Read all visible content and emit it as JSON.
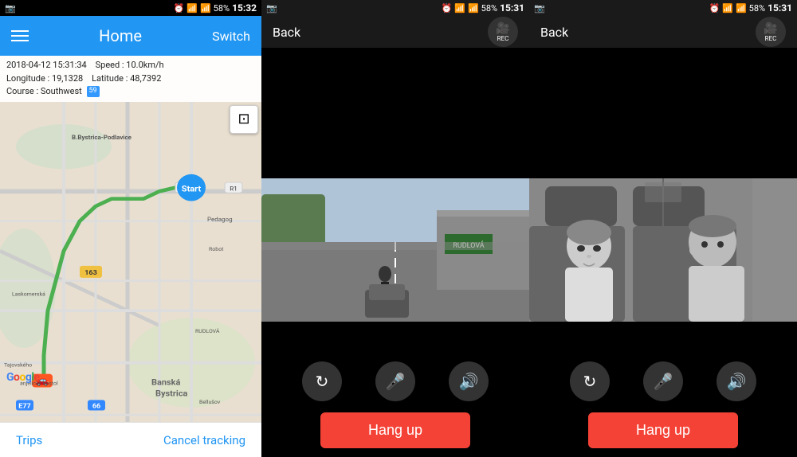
{
  "panel1": {
    "statusBar": {
      "time": "15:32",
      "battery": "58%"
    },
    "header": {
      "title": "Home",
      "switchLabel": "Switch"
    },
    "info": {
      "datetime": "2018-04-12  15:31:34",
      "speed": "Speed : 10.0km/h",
      "longitude": "Longitude : 19,1328",
      "latitude": "Latitude : 48,7392",
      "course": "Course : Southwest",
      "badge": "59"
    },
    "footer": {
      "trips": "Trips",
      "cancel": "Cancel tracking"
    },
    "mapCard": "▣"
  },
  "panel2": {
    "statusBar": {
      "time": "15:31",
      "battery": "58%"
    },
    "header": {
      "back": "Back",
      "rec": "REC"
    },
    "controls": {
      "rotate": "↻",
      "mute": "🎤",
      "speaker": "🔊"
    },
    "hangup": "Hang up"
  },
  "panel3": {
    "statusBar": {
      "time": "15:31",
      "battery": "58%"
    },
    "header": {
      "back": "Back",
      "rec": "REC"
    },
    "controls": {
      "rotate": "↻",
      "mute": "🎤",
      "speaker": "🔊"
    },
    "hangup": "Hang up"
  }
}
